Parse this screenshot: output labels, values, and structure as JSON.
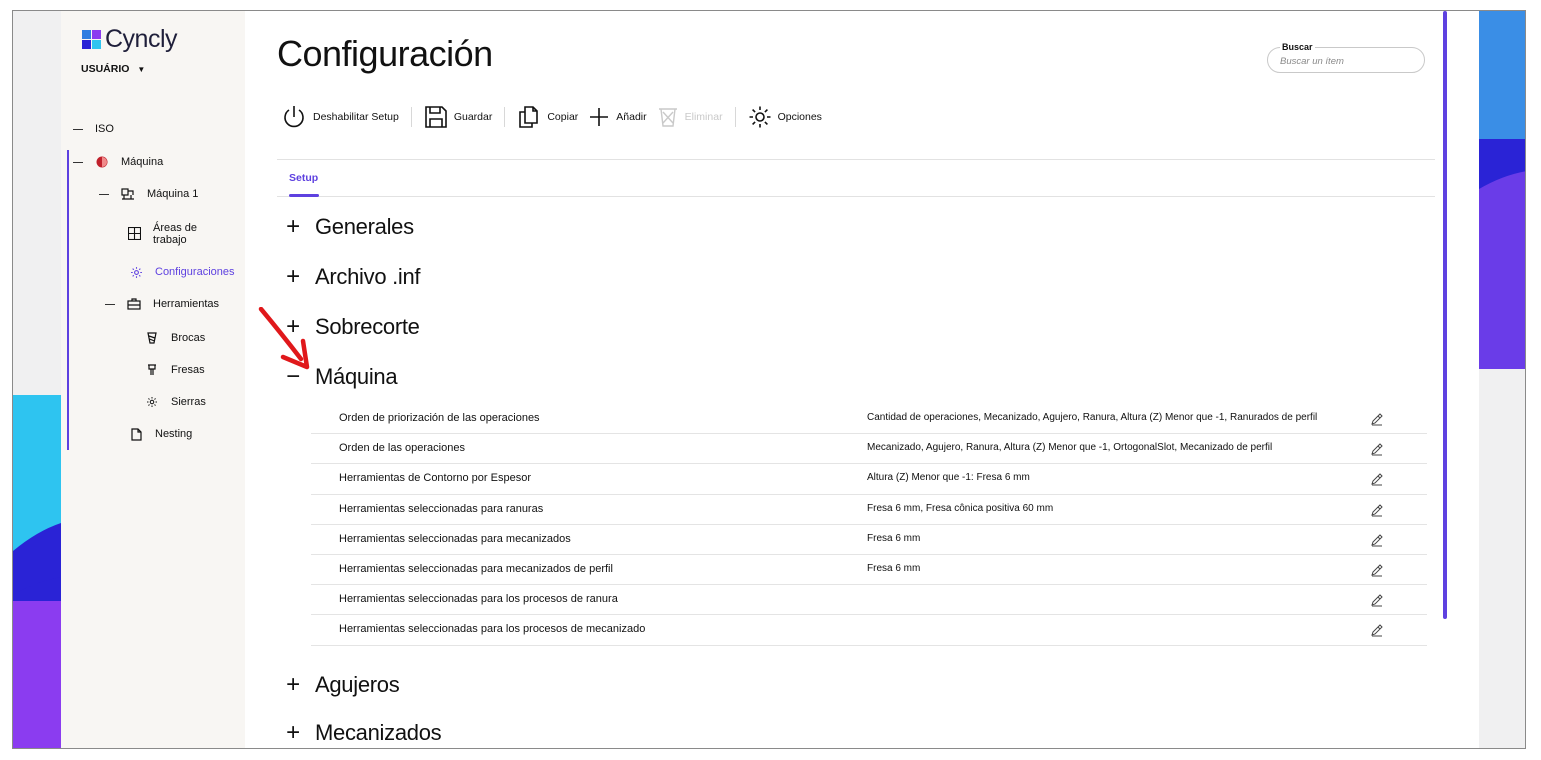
{
  "app": {
    "name": "Cyncly",
    "user_label": "USUÁRIO"
  },
  "colors": {
    "accent": "#5e41e0",
    "deco_blue": "#3a8ee6",
    "deco_navy": "#2a23d6",
    "deco_purple": "#8b3cf0",
    "deco_cyan": "#2ec4f0",
    "annotation_red": "#e0181b"
  },
  "sidebar": {
    "items": [
      {
        "label": "ISO",
        "icon": "dash-icon"
      },
      {
        "label": "Máquina",
        "icon": "machine-brand-icon"
      },
      {
        "label": "Máquina 1",
        "icon": "cnc-machine-icon"
      },
      {
        "label": "Áreas de",
        "label2": "trabajo",
        "icon": "grid-icon"
      },
      {
        "label": "Configuraciones",
        "icon": "gear-icon",
        "active": true
      },
      {
        "label": "Herramientas",
        "icon": "toolbox-icon"
      },
      {
        "label": "Brocas",
        "icon": "drill-bit-icon"
      },
      {
        "label": "Fresas",
        "icon": "mill-cutter-icon"
      },
      {
        "label": "Sierras",
        "icon": "saw-gear-icon"
      },
      {
        "label": "Nesting",
        "icon": "document-icon"
      }
    ]
  },
  "header": {
    "title": "Configuración"
  },
  "search": {
    "label": "Buscar",
    "placeholder": "Buscar un ítem"
  },
  "toolbar": {
    "disable_setup": "Deshabilitar Setup",
    "save": "Guardar",
    "copy": "Copiar",
    "add": "Añadir",
    "delete": "Eliminar",
    "options": "Opciones"
  },
  "tabs": [
    {
      "label": "Setup",
      "active": true
    }
  ],
  "sections": {
    "generales": {
      "label": "Generales",
      "sign": "+"
    },
    "archivo_inf": {
      "label": "Archivo .inf",
      "sign": "+"
    },
    "sobrecorte": {
      "label": "Sobrecorte",
      "sign": "+"
    },
    "maquina": {
      "label": "Máquina",
      "sign": "−"
    },
    "agujeros": {
      "label": "Agujeros",
      "sign": "+"
    },
    "mecanizados": {
      "label": "Mecanizados",
      "sign": "+"
    }
  },
  "maquina_rows": [
    {
      "label": "Orden de priorización de las operaciones",
      "value": "Cantidad de operaciones, Mecanizado, Agujero, Ranura, Altura (Z) Menor que -1, Ranurados de perfil"
    },
    {
      "label": "Orden de las operaciones",
      "value": "Mecanizado, Agujero, Ranura, Altura (Z) Menor que -1, OrtogonalSlot, Mecanizado de perfil"
    },
    {
      "label": "Herramientas de Contorno por Espesor",
      "value": "Altura (Z) Menor que -1: Fresa 6 mm"
    },
    {
      "label": "Herramientas seleccionadas para ranuras",
      "value": "Fresa 6 mm, Fresa cônica positiva 60 mm"
    },
    {
      "label": "Herramientas seleccionadas para mecanizados",
      "value": "Fresa 6 mm"
    },
    {
      "label": "Herramientas seleccionadas para mecanizados de perfil",
      "value": "Fresa 6 mm"
    },
    {
      "label": "Herramientas seleccionadas para los procesos de ranura",
      "value": ""
    },
    {
      "label": "Herramientas seleccionadas para los procesos de mecanizado",
      "value": ""
    }
  ]
}
